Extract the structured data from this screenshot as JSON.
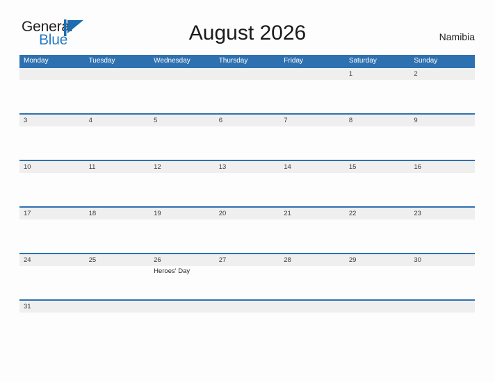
{
  "brand": {
    "name_part1": "General",
    "name_part2": "Blue",
    "flag_icon": "blue-flag-triangle",
    "accent_color": "#2a7ac4"
  },
  "header": {
    "title": "August 2026",
    "region": "Namibia"
  },
  "theme": {
    "header_blue": "#2e71b0",
    "row_band_gray": "#efefef",
    "page_background": "#fdfdfd",
    "text_color": "#231f20"
  },
  "calendar": {
    "month": "August",
    "year": "2026",
    "day_headers": [
      "Monday",
      "Tuesday",
      "Wednesday",
      "Thursday",
      "Friday",
      "Saturday",
      "Sunday"
    ],
    "weeks": [
      {
        "days": [
          {
            "date": "",
            "events": ""
          },
          {
            "date": "",
            "events": ""
          },
          {
            "date": "",
            "events": ""
          },
          {
            "date": "",
            "events": ""
          },
          {
            "date": "",
            "events": ""
          },
          {
            "date": "1",
            "events": ""
          },
          {
            "date": "2",
            "events": ""
          }
        ]
      },
      {
        "days": [
          {
            "date": "3",
            "events": ""
          },
          {
            "date": "4",
            "events": ""
          },
          {
            "date": "5",
            "events": ""
          },
          {
            "date": "6",
            "events": ""
          },
          {
            "date": "7",
            "events": ""
          },
          {
            "date": "8",
            "events": ""
          },
          {
            "date": "9",
            "events": ""
          }
        ]
      },
      {
        "days": [
          {
            "date": "10",
            "events": ""
          },
          {
            "date": "11",
            "events": ""
          },
          {
            "date": "12",
            "events": ""
          },
          {
            "date": "13",
            "events": ""
          },
          {
            "date": "14",
            "events": ""
          },
          {
            "date": "15",
            "events": ""
          },
          {
            "date": "16",
            "events": ""
          }
        ]
      },
      {
        "days": [
          {
            "date": "17",
            "events": ""
          },
          {
            "date": "18",
            "events": ""
          },
          {
            "date": "19",
            "events": ""
          },
          {
            "date": "20",
            "events": ""
          },
          {
            "date": "21",
            "events": ""
          },
          {
            "date": "22",
            "events": ""
          },
          {
            "date": "23",
            "events": ""
          }
        ]
      },
      {
        "days": [
          {
            "date": "24",
            "events": ""
          },
          {
            "date": "25",
            "events": ""
          },
          {
            "date": "26",
            "events": "Heroes' Day"
          },
          {
            "date": "27",
            "events": ""
          },
          {
            "date": "28",
            "events": ""
          },
          {
            "date": "29",
            "events": ""
          },
          {
            "date": "30",
            "events": ""
          }
        ]
      },
      {
        "days": [
          {
            "date": "31",
            "events": ""
          },
          {
            "date": "",
            "events": ""
          },
          {
            "date": "",
            "events": ""
          },
          {
            "date": "",
            "events": ""
          },
          {
            "date": "",
            "events": ""
          },
          {
            "date": "",
            "events": ""
          },
          {
            "date": "",
            "events": ""
          }
        ]
      }
    ]
  }
}
